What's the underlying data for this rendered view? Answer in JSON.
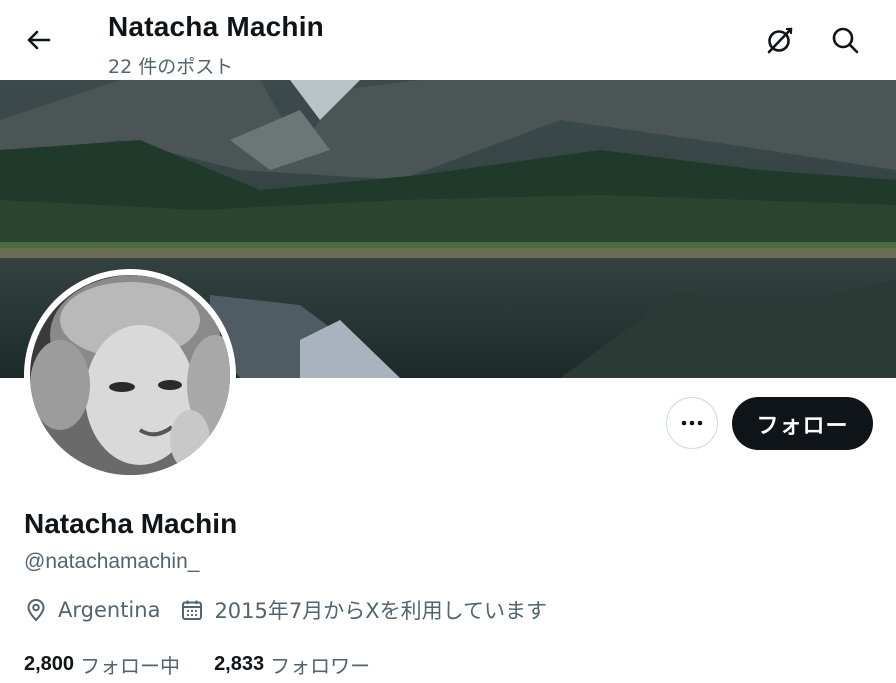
{
  "header": {
    "title": "Natacha Machin",
    "post_count": "22 件のポスト",
    "back_icon": "arrow-left-icon",
    "grok_icon": "grok-icon",
    "search_icon": "search-icon"
  },
  "profile": {
    "name": "Natacha Machin",
    "handle": "@natachamachin_",
    "location": "Argentina",
    "joined": "2015年7月からXを利用しています",
    "location_icon": "location-pin-icon",
    "calendar_icon": "calendar-icon"
  },
  "actions": {
    "more_icon": "more-horizontal-icon",
    "follow_label": "フォロー"
  },
  "stats": {
    "following_count": "2,800",
    "following_label": "フォロー中",
    "followers_count": "2,833",
    "followers_label": "フォロワー"
  },
  "colors": {
    "text_primary": "#0f1419",
    "text_secondary": "#536471",
    "follow_button_bg": "#0f1419",
    "border": "#cfd9de"
  }
}
